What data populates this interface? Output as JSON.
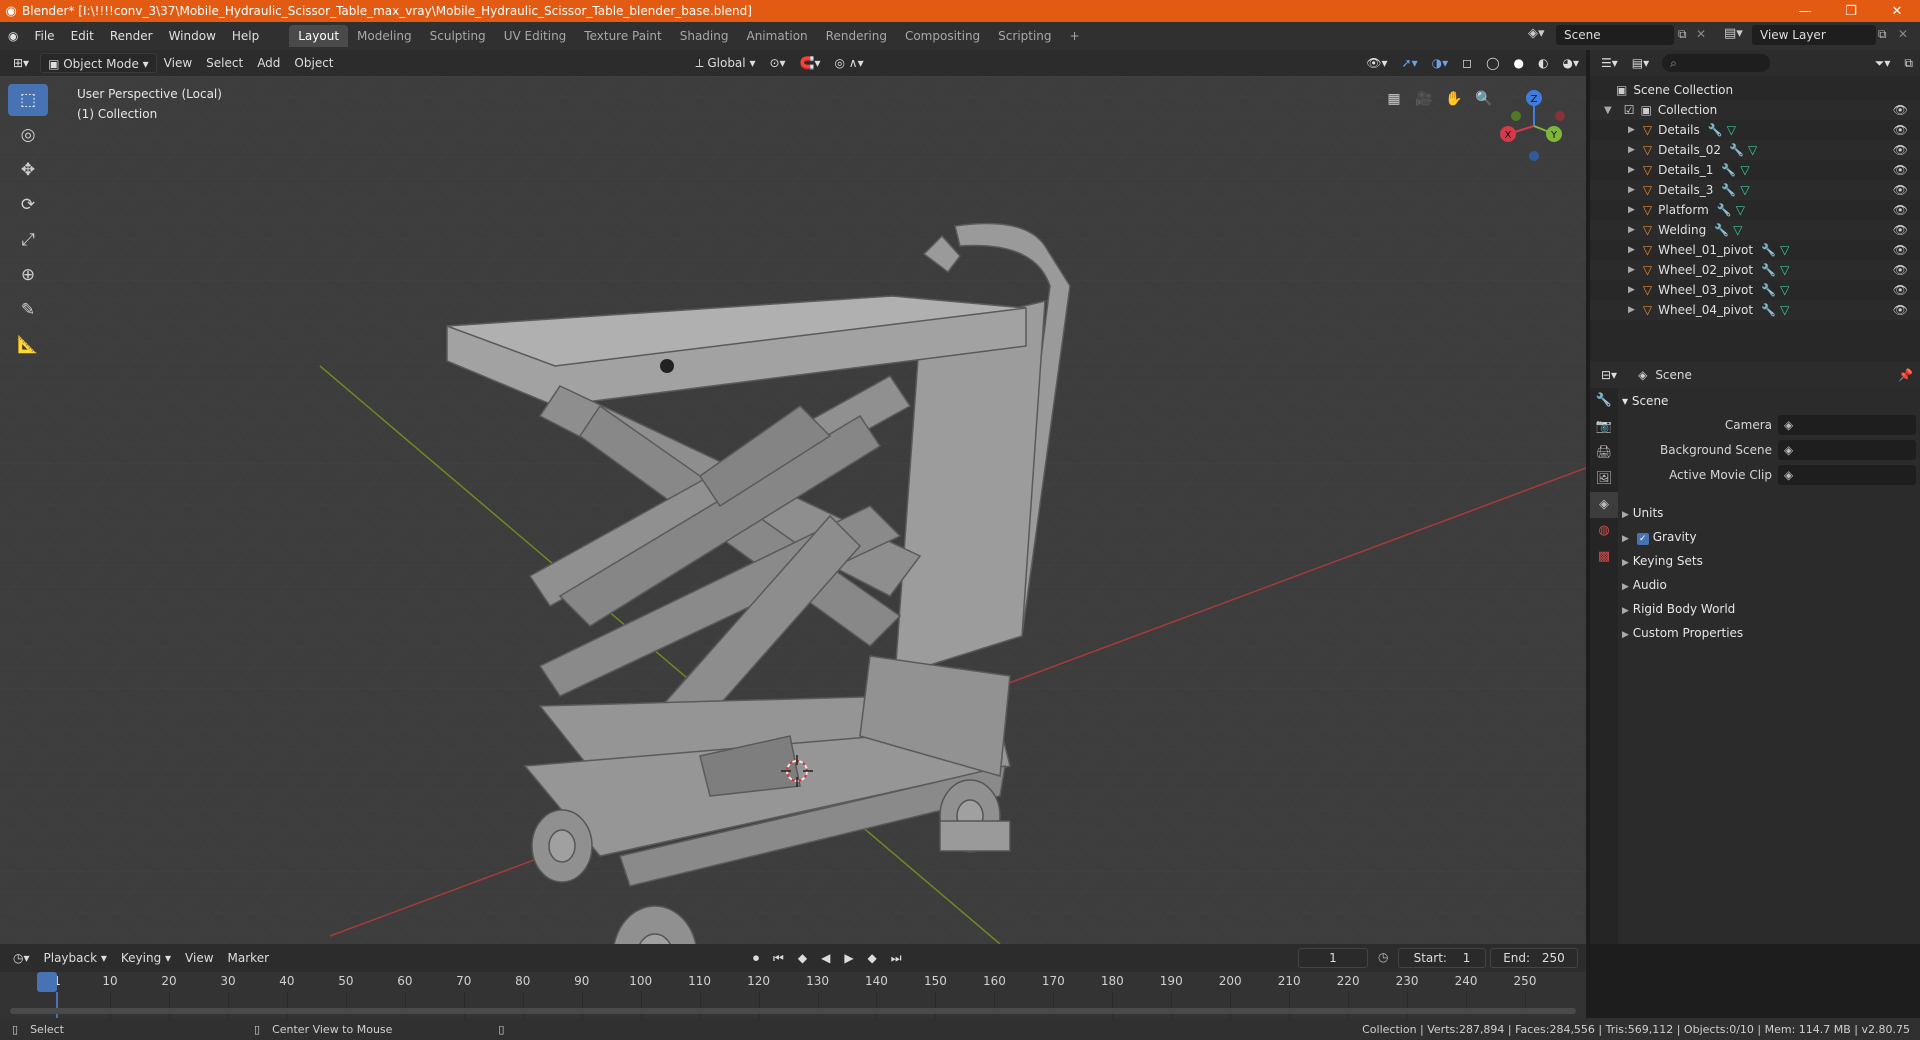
{
  "titlebar": {
    "title": "Blender* [I:\\!!!!conv_3\\37\\Mobile_Hydraulic_Scissor_Table_max_vray\\Mobile_Hydraulic_Scissor_Table_blender_base.blend]",
    "minimize": "—",
    "maximize": "❐",
    "close": "✕"
  },
  "menu": [
    "File",
    "Edit",
    "Render",
    "Window",
    "Help"
  ],
  "workspaces": [
    "Layout",
    "Modeling",
    "Sculpting",
    "UV Editing",
    "Texture Paint",
    "Shading",
    "Animation",
    "Rendering",
    "Compositing",
    "Scripting"
  ],
  "active_workspace": "Layout",
  "scene_name": "Scene",
  "view_layer": "View Layer",
  "viewport_header": {
    "mode": "Object Mode",
    "menus": [
      "View",
      "Select",
      "Add",
      "Object"
    ],
    "orientation": "Global"
  },
  "viewport": {
    "perspective": "User Perspective (Local)",
    "collection": "(1) Collection",
    "gizmo": {
      "x": "X",
      "y": "Y",
      "z": "Z"
    }
  },
  "outliner": {
    "root": "Scene Collection",
    "collection": "Collection",
    "items": [
      "Details",
      "Details_02",
      "Details_1",
      "Details_3",
      "Platform",
      "Welding",
      "Wheel_01_pivot",
      "Wheel_02_pivot",
      "Wheel_03_pivot",
      "Wheel_04_pivot"
    ]
  },
  "properties": {
    "context": "Scene",
    "panel": "Scene",
    "fields": [
      {
        "label": "Camera",
        "value": ""
      },
      {
        "label": "Background Scene",
        "value": ""
      },
      {
        "label": "Active Movie Clip",
        "value": ""
      }
    ],
    "sections": [
      "Units",
      "Gravity",
      "Keying Sets",
      "Audio",
      "Rigid Body World",
      "Custom Properties"
    ],
    "gravity_checked": true
  },
  "timeline": {
    "menus": [
      "Playback",
      "Keying",
      "View",
      "Marker"
    ],
    "current_frame": "1",
    "start_label": "Start:",
    "start": "1",
    "end_label": "End:",
    "end": "250",
    "ticks": [
      "1",
      "10",
      "20",
      "30",
      "40",
      "50",
      "60",
      "70",
      "80",
      "90",
      "100",
      "110",
      "120",
      "130",
      "140",
      "150",
      "160",
      "170",
      "180",
      "190",
      "200",
      "210",
      "220",
      "230",
      "240",
      "250"
    ]
  },
  "statusbar": {
    "select": "Select",
    "center_view": "Center View to Mouse",
    "stats": "Collection | Verts:287,894 | Faces:284,556 | Tris:569,112 | Objects:0/10 | Mem: 114.7 MB | v2.80.75"
  },
  "colors": {
    "titlebar": "#e35b12",
    "active_blue": "#4772b3",
    "mesh_icon": "#e68a3a",
    "modifier_icon": "#5fa8e8",
    "data_icon": "#3dc9a0"
  }
}
